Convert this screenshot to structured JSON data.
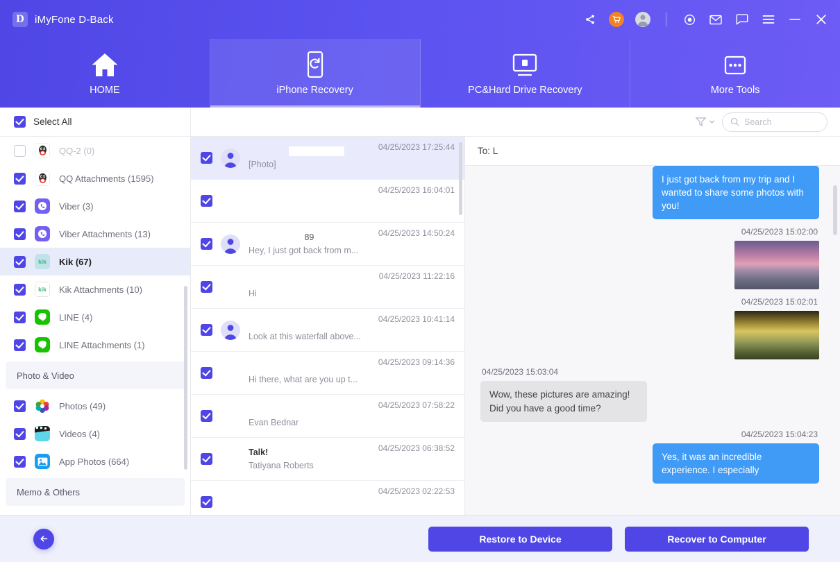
{
  "titlebar": {
    "brand_initial": "D",
    "brand_name": "iMyFone D-Back",
    "icons": [
      "share-icon",
      "cart-icon",
      "avatar-icon",
      "target-icon",
      "mail-icon",
      "chat-icon",
      "menu-icon",
      "minimize-icon",
      "close-icon"
    ]
  },
  "nav": {
    "tabs": [
      {
        "label": "HOME",
        "icon": "home-icon",
        "active": false
      },
      {
        "label": "iPhone Recovery",
        "icon": "phone-refresh-icon",
        "active": true
      },
      {
        "label": "PC&Hard Drive Recovery",
        "icon": "monitor-icon",
        "active": false
      },
      {
        "label": "More Tools",
        "icon": "more-dots-icon",
        "active": false
      }
    ]
  },
  "toolbar": {
    "select_all_label": "Select All",
    "select_all_checked": true,
    "filter_label": "filter-icon",
    "search_placeholder": "Search",
    "search_value": ""
  },
  "sidebar": {
    "items": [
      {
        "type": "item",
        "label": "QQ-2 (0)",
        "checked": false,
        "selected": false,
        "dim": true,
        "icon": "qq-icon"
      },
      {
        "type": "item",
        "label": "QQ Attachments (1595)",
        "checked": true,
        "selected": false,
        "dim": false,
        "icon": "qq-icon"
      },
      {
        "type": "item",
        "label": "Viber (3)",
        "checked": true,
        "selected": false,
        "dim": false,
        "icon": "viber-icon"
      },
      {
        "type": "item",
        "label": "Viber Attachments (13)",
        "checked": true,
        "selected": false,
        "dim": false,
        "icon": "viber-icon"
      },
      {
        "type": "item",
        "label": "Kik (67)",
        "checked": true,
        "selected": true,
        "dim": false,
        "icon": "kik-icon"
      },
      {
        "type": "item",
        "label": "Kik Attachments (10)",
        "checked": true,
        "selected": false,
        "dim": false,
        "icon": "kik-attach-icon"
      },
      {
        "type": "item",
        "label": "LINE (4)",
        "checked": true,
        "selected": false,
        "dim": false,
        "icon": "line-icon"
      },
      {
        "type": "item",
        "label": "LINE Attachments (1)",
        "checked": true,
        "selected": false,
        "dim": false,
        "icon": "line-icon"
      },
      {
        "type": "group",
        "label": "Photo & Video"
      },
      {
        "type": "item",
        "label": "Photos (49)",
        "checked": true,
        "selected": false,
        "dim": false,
        "icon": "photos-icon"
      },
      {
        "type": "item",
        "label": "Videos (4)",
        "checked": true,
        "selected": false,
        "dim": false,
        "icon": "videos-icon"
      },
      {
        "type": "item",
        "label": "App Photos (664)",
        "checked": true,
        "selected": false,
        "dim": false,
        "icon": "app-photos-icon"
      },
      {
        "type": "group",
        "label": "Memo & Others"
      },
      {
        "type": "item",
        "label": "",
        "checked": true,
        "selected": false,
        "dim": false,
        "icon": "notes-icon"
      }
    ]
  },
  "message_list": {
    "rows": [
      {
        "title": "",
        "title_style": "redact",
        "subtitle": "[Photo]",
        "time": "04/25/2023 17:25:44",
        "checked": true,
        "selected": true,
        "avatar": true
      },
      {
        "title": "",
        "title_style": "blur",
        "subtitle": "",
        "time": "04/25/2023 16:04:01",
        "checked": true,
        "selected": false,
        "avatar": false
      },
      {
        "title": "89",
        "title_style": "center",
        "subtitle": "Hey, I just got back from m...",
        "time": "04/25/2023 14:50:24",
        "checked": true,
        "selected": false,
        "avatar": true
      },
      {
        "title": "",
        "title_style": "plain",
        "subtitle": "Hi",
        "time": "04/25/2023 11:22:16",
        "checked": true,
        "selected": false,
        "avatar": false
      },
      {
        "title": "",
        "title_style": "plain",
        "subtitle": "Look at this waterfall above...",
        "time": "04/25/2023 10:41:14",
        "checked": true,
        "selected": false,
        "avatar": true
      },
      {
        "title": "",
        "title_style": "plain",
        "subtitle": "Hi there, what are you up t...",
        "time": "04/25/2023 09:14:36",
        "checked": true,
        "selected": false,
        "avatar": false
      },
      {
        "title": "",
        "title_style": "blur",
        "subtitle": "Evan Bednar",
        "time": "04/25/2023 07:58:22",
        "checked": true,
        "selected": false,
        "avatar": false
      },
      {
        "title": "Talk!",
        "title_style": "plain",
        "subtitle": "Tatiyana Roberts",
        "time": "04/25/2023 06:38:52",
        "checked": true,
        "selected": false,
        "avatar": false
      },
      {
        "title": "",
        "title_style": "plain",
        "subtitle": "",
        "time": "04/25/2023 02:22:53",
        "checked": true,
        "selected": false,
        "avatar": false
      }
    ]
  },
  "chat": {
    "header_to": "To: L",
    "messages": [
      {
        "kind": "text",
        "side": "out",
        "text": "I just got back from my trip and I wanted to share some photos with you!",
        "time": ""
      },
      {
        "kind": "photo",
        "side": "out",
        "time": "04/25/2023 15:02:00",
        "photo": "sunset-boat-photo"
      },
      {
        "kind": "photo",
        "side": "out",
        "time": "04/25/2023 15:02:01",
        "photo": "golden-trees-photo"
      },
      {
        "kind": "text",
        "side": "in",
        "text": "Wow, these pictures are amazing! Did you have a good time?",
        "time": "04/25/2023 15:03:04"
      },
      {
        "kind": "text",
        "side": "out",
        "text": "Yes, it was an incredible experience. I especially",
        "time": "04/25/2023 15:04:23"
      }
    ]
  },
  "footer": {
    "back_label": "back-arrow-icon",
    "restore_label": "Restore to Device",
    "recover_label": "Recover to Computer"
  },
  "colors": {
    "brand_purple": "#4f46e5",
    "header_gradient_end": "#6d5cf5",
    "cart_orange": "#f58220",
    "bubble_out": "#3f9bf5",
    "bubble_in": "#e4e4e6",
    "selected_row": "#e9eafb",
    "footer_bg": "#eef0fb"
  }
}
